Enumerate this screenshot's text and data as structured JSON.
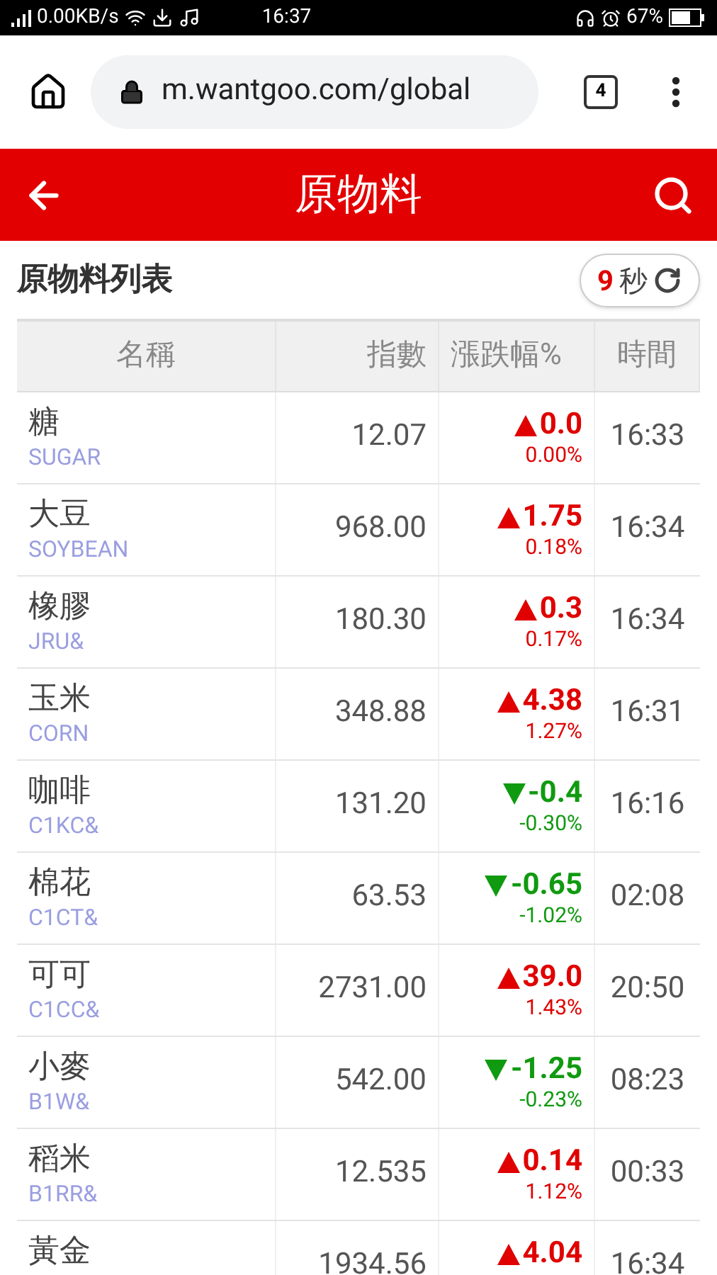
{
  "status_bar": {
    "network_speed": "0.00KB/s",
    "time": "16:37",
    "battery": "67%"
  },
  "browser": {
    "url": "m.wantgoo.com/global",
    "tab_count": "4"
  },
  "header": {
    "title": "原物料"
  },
  "section": {
    "title": "原物料列表",
    "countdown": "9",
    "countdown_unit": "秒"
  },
  "table": {
    "columns": [
      "名稱",
      "指數",
      "漲跌幅%",
      "時間"
    ],
    "rows": [
      {
        "name": "糖",
        "code": "SUGAR",
        "price": "12.07",
        "change": "0.0",
        "pct": "0.00%",
        "time": "16:33",
        "kind": "up"
      },
      {
        "name": "大豆",
        "code": "SOYBEAN",
        "price": "968.00",
        "change": "1.75",
        "pct": "0.18%",
        "time": "16:34",
        "kind": "up"
      },
      {
        "name": "橡膠",
        "code": "JRU&",
        "price": "180.30",
        "change": "0.3",
        "pct": "0.17%",
        "time": "16:34",
        "kind": "up"
      },
      {
        "name": "玉米",
        "code": "CORN",
        "price": "348.88",
        "change": "4.38",
        "pct": "1.27%",
        "time": "16:31",
        "kind": "up"
      },
      {
        "name": "咖啡",
        "code": "C1KC&",
        "price": "131.20",
        "change": "-0.4",
        "pct": "-0.30%",
        "time": "16:16",
        "kind": "down"
      },
      {
        "name": "棉花",
        "code": "C1CT&",
        "price": "63.53",
        "change": "-0.65",
        "pct": "-1.02%",
        "time": "02:08",
        "kind": "down"
      },
      {
        "name": "可可",
        "code": "C1CC&",
        "price": "2731.00",
        "change": "39.0",
        "pct": "1.43%",
        "time": "20:50",
        "kind": "up"
      },
      {
        "name": "小麥",
        "code": "B1W&",
        "price": "542.00",
        "change": "-1.25",
        "pct": "-0.23%",
        "time": "08:23",
        "kind": "down"
      },
      {
        "name": "稻米",
        "code": "B1RR&",
        "price": "12.535",
        "change": "0.14",
        "pct": "1.12%",
        "time": "00:33",
        "kind": "up"
      },
      {
        "name": "黃金",
        "price": "1934.56",
        "change": "4.04",
        "time": "16:34",
        "kind": "up"
      }
    ]
  }
}
